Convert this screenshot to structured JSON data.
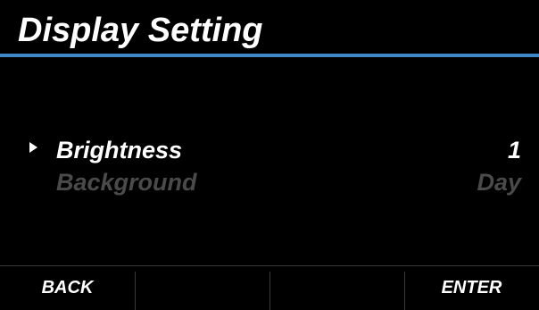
{
  "screen": {
    "title": "Display Setting",
    "accent_color": "#3f87c6"
  },
  "menu": {
    "items": [
      {
        "label": "Brightness",
        "value": "1",
        "selected": true
      },
      {
        "label": "Background",
        "value": "Day",
        "selected": false
      }
    ],
    "cursor_icon": "triangle-right-icon"
  },
  "softkeys": [
    {
      "label": "BACK"
    },
    {
      "label": ""
    },
    {
      "label": ""
    },
    {
      "label": "ENTER"
    }
  ]
}
